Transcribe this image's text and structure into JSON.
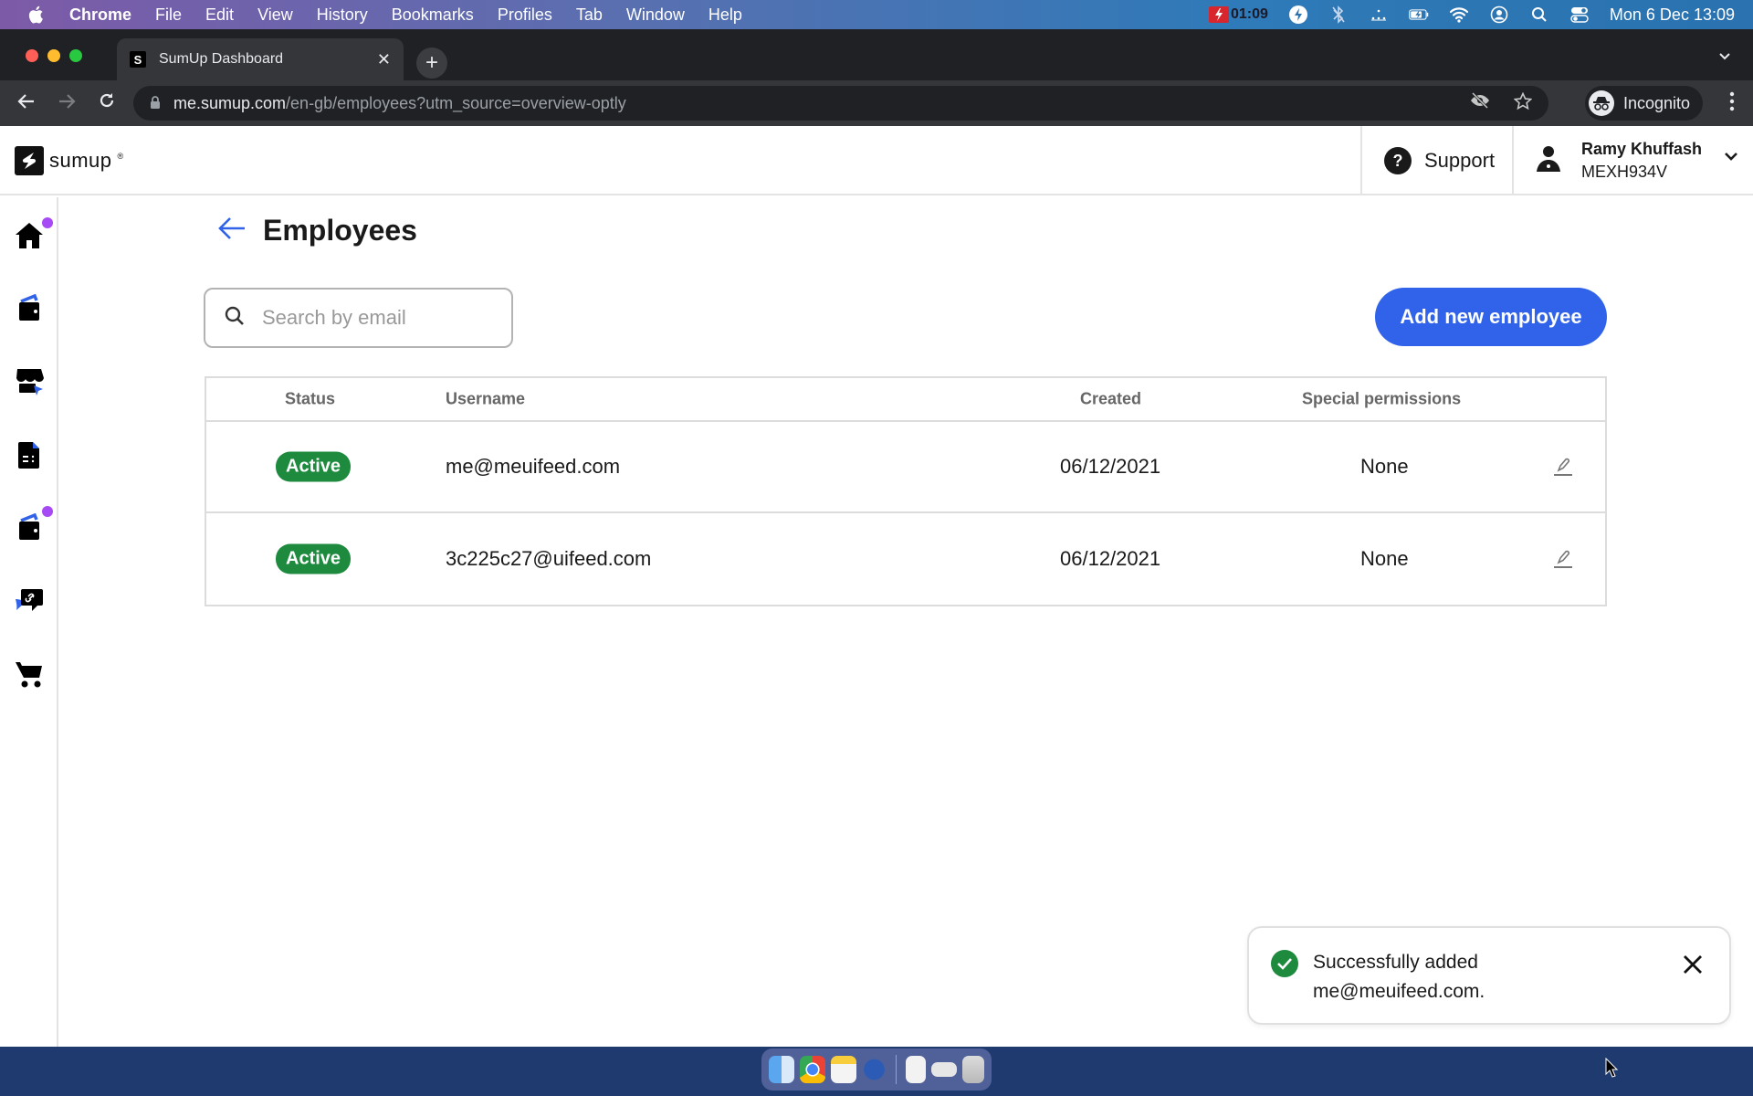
{
  "menubar": {
    "app": "Chrome",
    "items": [
      "File",
      "Edit",
      "View",
      "History",
      "Bookmarks",
      "Profiles",
      "Tab",
      "Window",
      "Help"
    ],
    "record_time": "01:09",
    "datetime": "Mon 6 Dec  13:09"
  },
  "browser": {
    "tab_title": "SumUp Dashboard",
    "url_host": "me.sumup.com",
    "url_path": "/en-gb/employees?utm_source=overview-optly",
    "profile_label": "Incognito"
  },
  "header": {
    "logo_text": "sumup",
    "support_label": "Support",
    "user_name": "Ramy Khuffash",
    "merchant_id": "MEXH934V"
  },
  "sidebar": {
    "items": [
      {
        "icon": "home-icon",
        "notification": true
      },
      {
        "icon": "wallet-icon",
        "notification": false
      },
      {
        "icon": "store-icon",
        "notification": false
      },
      {
        "icon": "invoice-icon",
        "notification": false
      },
      {
        "icon": "wallet-icon",
        "notification": true
      },
      {
        "icon": "payment-link-icon",
        "notification": false
      },
      {
        "icon": "cart-icon",
        "notification": false
      }
    ],
    "notification_color": "#a64af5"
  },
  "main": {
    "title": "Employees",
    "search_placeholder": "Search by email",
    "search_value": "",
    "add_button_label": "Add new employee",
    "accent_color": "#3063e9",
    "table": {
      "headers": [
        "Status",
        "Username",
        "Created",
        "Special permissions"
      ],
      "rows": [
        {
          "status": "Active",
          "username": "me@meuifeed.com",
          "created": "06/12/2021",
          "permissions": "None"
        },
        {
          "status": "Active",
          "username": "3c225c27@uifeed.com",
          "created": "06/12/2021",
          "permissions": "None"
        }
      ]
    }
  },
  "toast": {
    "line1": "Successfully added",
    "line2": "me@meuifeed.com.",
    "success_color": "#1d8a3e"
  }
}
